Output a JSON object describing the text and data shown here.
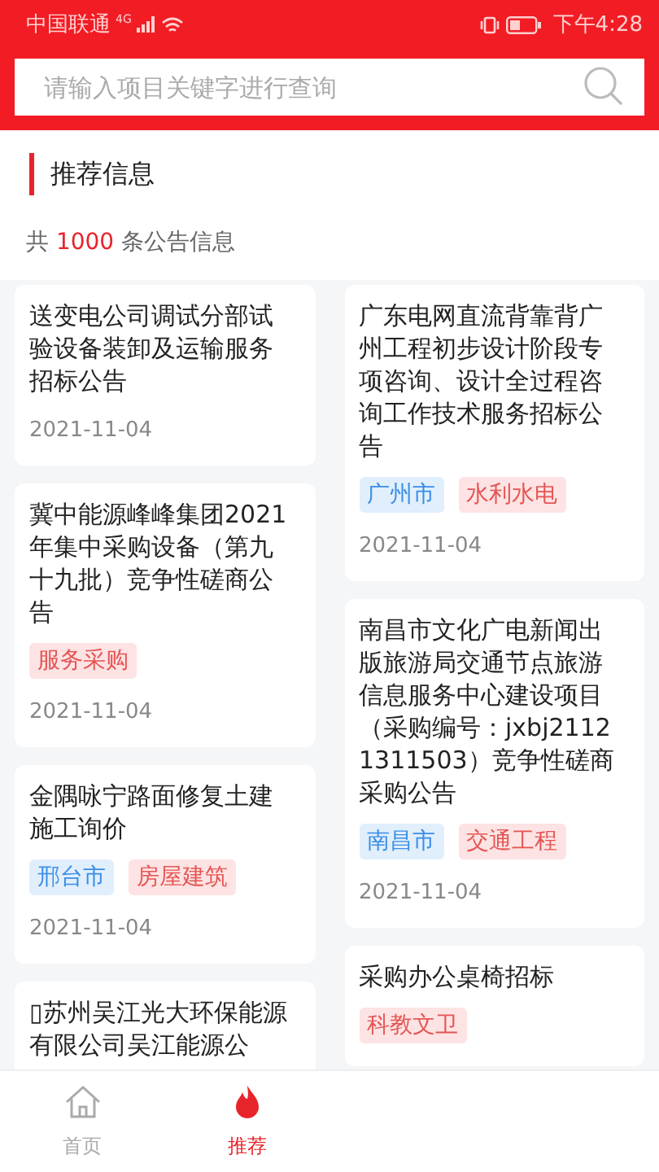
{
  "status_bar": {
    "carrier": "中国联通",
    "network": "4G",
    "time": "下午4:28"
  },
  "search": {
    "placeholder": "请输入项目关键字进行查询"
  },
  "section_title": "推荐信息",
  "count": {
    "prefix": "共",
    "number": "1000",
    "suffix": "条公告信息"
  },
  "columns": [
    [
      {
        "title": "送变电公司调试分部试验设备装卸及运输服务招标公告",
        "date": "2021-11-04"
      },
      {
        "title": "冀中能源峰峰集团2021年集中采购设备（第九十九批）竞争性磋商公告",
        "tags": [
          {
            "label": "服务采购",
            "kind": "category"
          }
        ],
        "date": "2021-11-04"
      },
      {
        "title": "金隅咏宁路面修复土建施工询价",
        "tags": [
          {
            "label": "邢台市",
            "kind": "region"
          },
          {
            "label": "房屋建筑",
            "kind": "category"
          }
        ],
        "date": "2021-11-04"
      },
      {
        "title": "▯苏州吴江光大环保能源有限公司吴江能源公"
      }
    ],
    [
      {
        "title": "广东电网直流背靠背广州工程初步设计阶段专项咨询、设计全过程咨询工作技术服务招标公告",
        "tags": [
          {
            "label": "广州市",
            "kind": "region"
          },
          {
            "label": "水利水电",
            "kind": "category"
          }
        ],
        "date": "2021-11-04"
      },
      {
        "title": "南昌市文化广电新闻出版旅游局交通节点旅游信息服务中心建设项目（采购编号：jxbj21121311503）竞争性磋商采购公告",
        "tags": [
          {
            "label": "南昌市",
            "kind": "region"
          },
          {
            "label": "交通工程",
            "kind": "category"
          }
        ],
        "date": "2021-11-04"
      },
      {
        "title": "采购办公桌椅招标",
        "tags": [
          {
            "label": "科教文卫",
            "kind": "category"
          }
        ]
      }
    ]
  ],
  "tabs": [
    {
      "label": "首页",
      "selected": false
    },
    {
      "label": "推荐",
      "selected": true
    }
  ]
}
